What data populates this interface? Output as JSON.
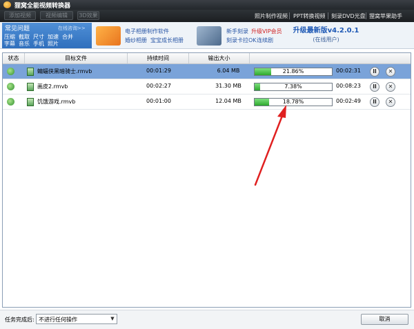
{
  "window": {
    "title": "狸窝全能视频转换器"
  },
  "toolbar": {
    "buttons": [
      "添加视频",
      "视频编辑",
      "3D效果"
    ],
    "links": [
      "照片制作视频",
      "PPT转换视频",
      "刻录DVD光盘",
      "狸窝苹果助手"
    ]
  },
  "faq": {
    "title": "常见问题",
    "online": "在线咨询>>",
    "line1": [
      "压缩",
      "截取",
      "尺寸",
      "加速",
      "合并"
    ],
    "line2": [
      "字幕",
      "音乐",
      "手机",
      "照片"
    ]
  },
  "promo1": {
    "line1": "电子相册制作软件",
    "line2": [
      "婚纱相册",
      "宝宝成长相册"
    ]
  },
  "promo2": {
    "line1_a": "新手刻录",
    "line1_b": "升级VIP会员",
    "line2": [
      "刻录卡拉OK",
      "连续剧"
    ]
  },
  "upgrade": {
    "title": "升级最新版v4.2.0.1",
    "subtitle": "(在线用户)"
  },
  "table": {
    "headers": [
      "状态",
      "目标文件",
      "持续时间",
      "输出大小"
    ],
    "rows": [
      {
        "file": "蝙蝠侠黑暗骑士.rmvb",
        "duration": "00:01:29",
        "size": "6.04 MB",
        "progress": 21.86,
        "progress_text": "21.86%",
        "remaining": "00:02:31",
        "selected": true
      },
      {
        "file": "画皮2.rmvb",
        "duration": "00:02:27",
        "size": "31.30 MB",
        "progress": 7.38,
        "progress_text": "7.38%",
        "remaining": "00:08:23",
        "selected": false
      },
      {
        "file": "饥饿游戏.rmvb",
        "duration": "00:01:00",
        "size": "12.04 MB",
        "progress": 18.78,
        "progress_text": "18.78%",
        "remaining": "00:02:49",
        "selected": false
      }
    ]
  },
  "footer": {
    "after_label": "任务完成后:",
    "after_value": "不进行任何操作",
    "cancel": "取消"
  },
  "colors": {
    "accent": "#2f6fbd",
    "progress": "#2ea82e",
    "selected_row": "#7aa3d9",
    "arrow": "#e02020"
  },
  "icons": {
    "pause": "pause-icon",
    "remove": "close-icon",
    "status": "refresh-icon",
    "file": "film-icon"
  }
}
